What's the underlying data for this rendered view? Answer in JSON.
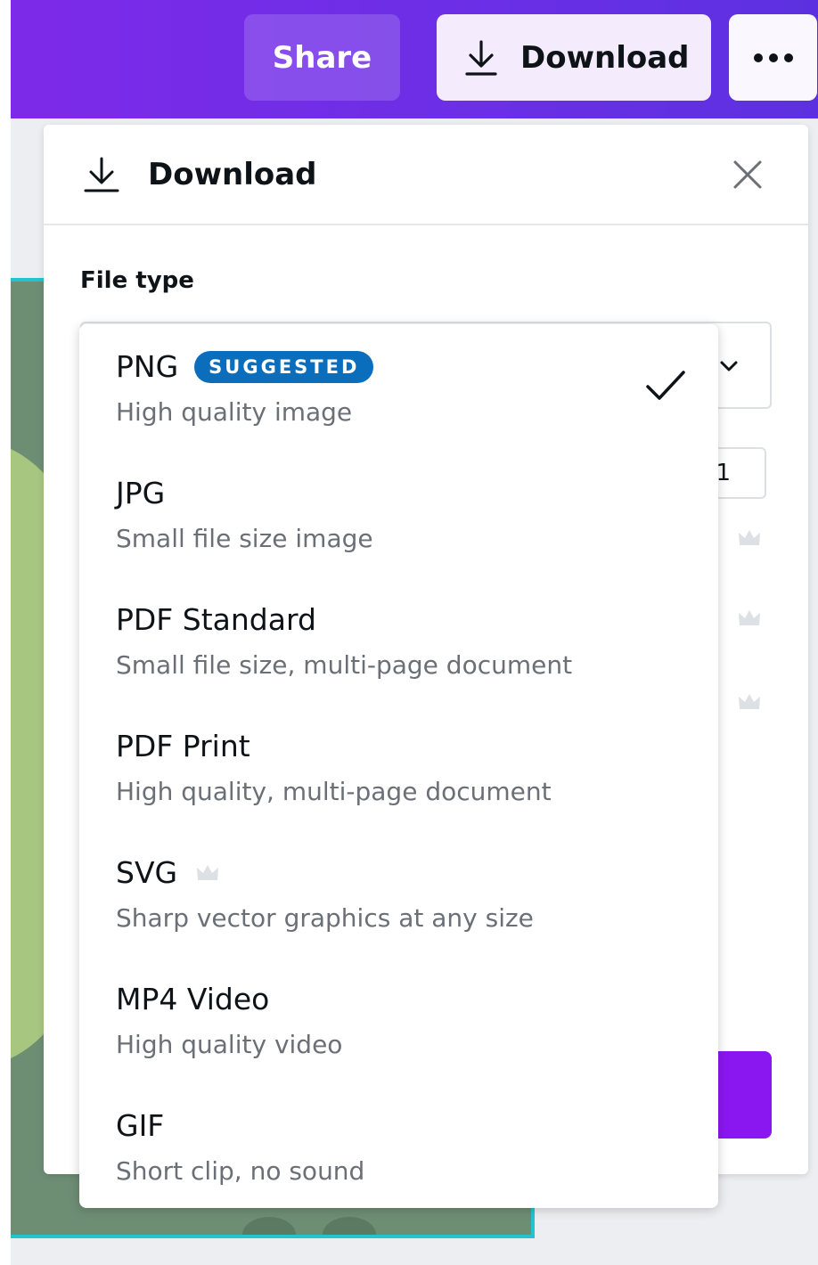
{
  "topbar": {
    "share_label": "Share",
    "download_label": "Download",
    "more_icon": "more-horizontal-icon"
  },
  "panel": {
    "title": "Download",
    "file_type_label": "File type",
    "size_value": "1"
  },
  "dropdown": {
    "options": [
      {
        "name": "PNG",
        "badge": "SUGGESTED",
        "description": "High quality image",
        "selected": true
      },
      {
        "name": "JPG",
        "description": "Small file size image"
      },
      {
        "name": "PDF Standard",
        "description": "Small file size, multi-page document"
      },
      {
        "name": "PDF Print",
        "description": "High quality, multi-page document"
      },
      {
        "name": "SVG",
        "premium": true,
        "description": "Sharp vector graphics at any size"
      },
      {
        "name": "MP4 Video",
        "description": "High quality video"
      },
      {
        "name": "GIF",
        "description": "Short clip, no sound"
      }
    ]
  },
  "colors": {
    "brand_purple": "#7d2ae8",
    "badge_blue": "#0a6ebd",
    "canvas_green": "#6e8e74",
    "accent_teal": "#22c4cf"
  }
}
